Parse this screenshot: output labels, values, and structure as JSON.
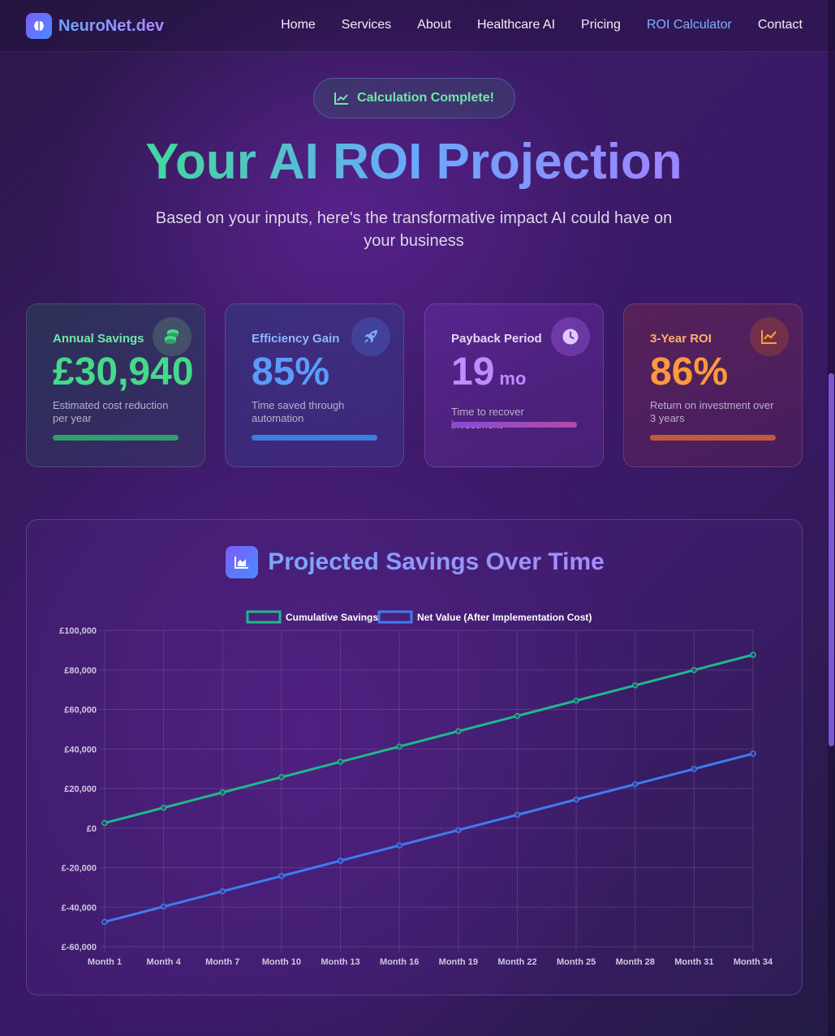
{
  "nav": {
    "brand": "NeuroNet.dev",
    "links": [
      "Home",
      "Services",
      "About",
      "Healthcare AI",
      "Pricing",
      "ROI Calculator",
      "Contact"
    ],
    "active": "ROI Calculator"
  },
  "hero": {
    "badge": "Calculation Complete!",
    "title": "Your AI ROI Projection",
    "subtitle": "Based on your inputs, here's the transformative impact AI could have on your business"
  },
  "cards": [
    {
      "label": "Annual Savings",
      "value": "£30,940",
      "unit": "",
      "desc": "Estimated cost reduction per year",
      "icon": "coins-icon",
      "color": "#45d98a"
    },
    {
      "label": "Efficiency Gain",
      "value": "85%",
      "unit": "",
      "desc": "Time saved through automation",
      "icon": "rocket-icon",
      "color": "#5b9bff"
    },
    {
      "label": "Payback Period",
      "value": "19",
      "unit": "mo",
      "desc": "Time to recover investment",
      "icon": "clock-icon",
      "color": "#c08cff"
    },
    {
      "label": "3-Year ROI",
      "value": "86%",
      "unit": "",
      "desc": "Return on investment over 3 years",
      "icon": "chart-line-icon",
      "color": "#ff9a3c"
    }
  ],
  "chart_panel": {
    "title": "Projected Savings Over Time"
  },
  "chart_data": {
    "type": "line",
    "categories": [
      "Month 1",
      "Month 4",
      "Month 7",
      "Month 10",
      "Month 13",
      "Month 16",
      "Month 19",
      "Month 22",
      "Month 25",
      "Month 28",
      "Month 31",
      "Month 34"
    ],
    "series": [
      {
        "name": "Cumulative Savings",
        "color": "#1fb889",
        "values": [
          2578,
          10313,
          18048,
          25783,
          33518,
          41253,
          48988,
          56723,
          64458,
          72193,
          79928,
          87663
        ]
      },
      {
        "name": "Net Value (After Implementation Cost)",
        "color": "#3f7bf0",
        "values": [
          -47422,
          -39687,
          -31952,
          -24217,
          -16482,
          -8747,
          -1012,
          6723,
          14458,
          22193,
          29928,
          37663
        ]
      }
    ],
    "ylim": [
      -60000,
      100000
    ],
    "yticks": [
      100000,
      80000,
      60000,
      40000,
      20000,
      0,
      -20000,
      -40000,
      -60000
    ],
    "ytick_labels": [
      "£100,000",
      "£80,000",
      "£60,000",
      "£40,000",
      "£20,000",
      "£0",
      "£-20,000",
      "£-40,000",
      "£-60,000"
    ],
    "grid": true,
    "legend_position": "top"
  }
}
